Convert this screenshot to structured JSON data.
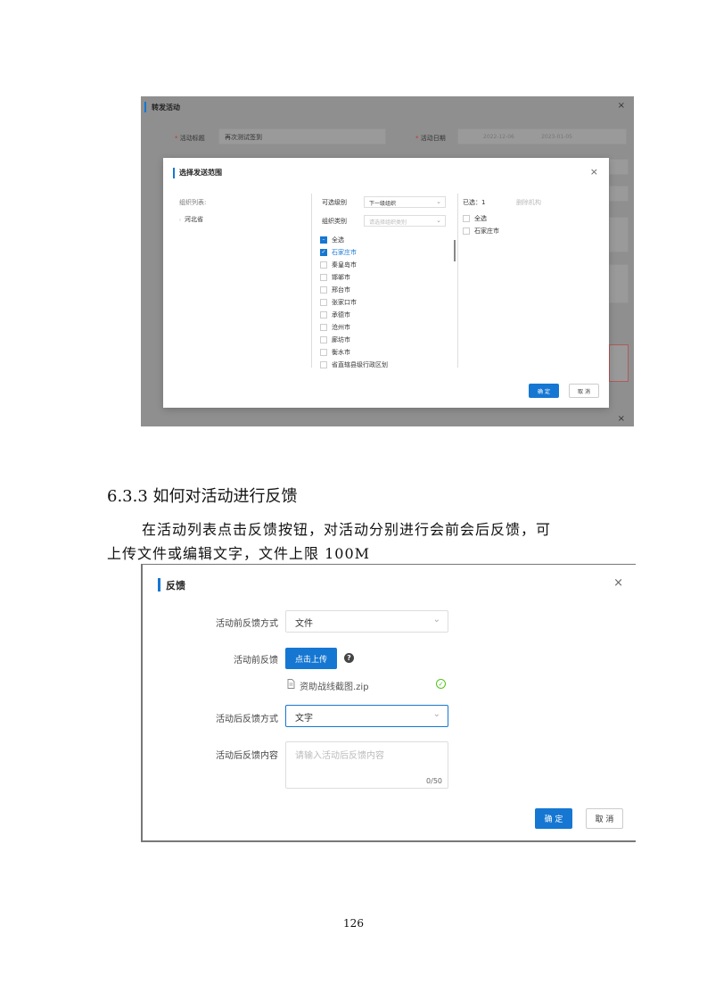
{
  "forward_dialog": {
    "title": "转发活动",
    "close": "×",
    "activity_title_label": "活动标题",
    "activity_title_value": "再次测试签到",
    "activity_date_label": "活动日期",
    "date_start": "2022-12-06",
    "date_end": "2023-01-05",
    "required_mark": "*"
  },
  "scope_dialog": {
    "title": "选择发送范围",
    "close": "×",
    "org_list_label": "组织列表:",
    "tree_items": [
      "河北省"
    ],
    "level_label": "可选级别",
    "level_value": "下一级组织",
    "category_label": "组织类别",
    "category_placeholder": "请选择组织类别",
    "options": [
      {
        "label": "全选",
        "state": "partial"
      },
      {
        "label": "石家庄市",
        "state": "checked"
      },
      {
        "label": "秦皇岛市",
        "state": "unchecked"
      },
      {
        "label": "邯郸市",
        "state": "unchecked"
      },
      {
        "label": "邢台市",
        "state": "unchecked"
      },
      {
        "label": "张家口市",
        "state": "unchecked"
      },
      {
        "label": "承德市",
        "state": "unchecked"
      },
      {
        "label": "沧州市",
        "state": "unchecked"
      },
      {
        "label": "廊坊市",
        "state": "unchecked"
      },
      {
        "label": "衡水市",
        "state": "unchecked"
      },
      {
        "label": "省直辖县级行政区划",
        "state": "unchecked"
      }
    ],
    "selected_label": "已选：1",
    "delete_org": "删除机构",
    "selected_items": [
      "全选",
      "石家庄市"
    ],
    "confirm": "确 定",
    "cancel": "取 消"
  },
  "section": {
    "heading": "6.3.3 如何对活动进行反馈",
    "para_line1": "在活动列表点击反馈按钮，对活动分别进行会前会后反馈，可",
    "para_line2": "上传文件或编辑文字，文件上限 100M"
  },
  "feedback_dialog": {
    "title": "反馈",
    "close": "×",
    "before_method_label": "活动前反馈方式",
    "before_method_value": "文件",
    "before_feedback_label": "活动前反馈",
    "upload_button": "点击上传",
    "help": "?",
    "file_name": "资助战线截图.zip",
    "after_method_label": "活动后反馈方式",
    "after_method_value": "文字",
    "after_content_label": "活动后反馈内容",
    "after_content_placeholder": "请输入活动后反馈内容",
    "char_count": "0/50",
    "confirm": "确 定",
    "cancel": "取 消"
  },
  "page_number": "126",
  "colors": {
    "accent": "#1677d2",
    "success": "#52c41a",
    "overlay": "#8f8f8f"
  }
}
